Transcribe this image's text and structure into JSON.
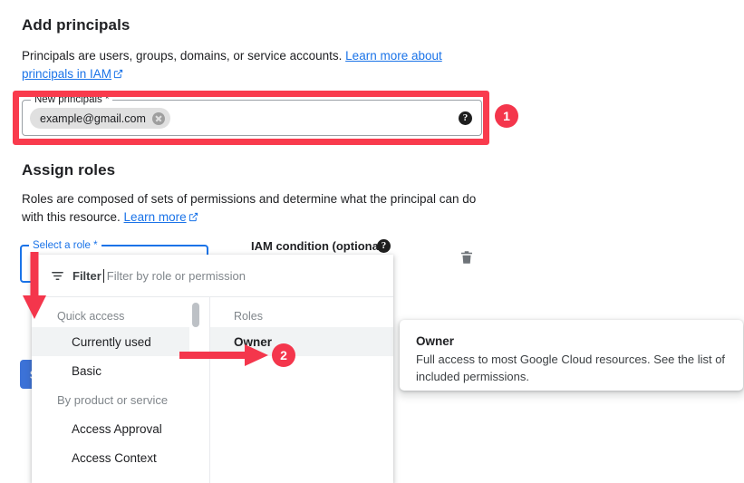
{
  "add_principals": {
    "title": "Add principals",
    "description_before": "Principals are users, groups, domains, or service accounts. ",
    "link_text": "Learn more about principals in IAM",
    "field_label": "New principals *",
    "chip_value": "example@gmail.com",
    "remove_icon": "close-circle-icon",
    "help_icon": "help-icon"
  },
  "assign_roles": {
    "title": "Assign roles",
    "description_before": "Roles are composed of sets of permissions and determine what the principal can do with this resource. ",
    "link_text": "Learn more",
    "role_field_label": "Select a role *",
    "iam_condition_label": "IAM condition (optional)",
    "iam_help_icon": "help-icon",
    "delete_icon": "trash-icon",
    "save_label": "S"
  },
  "role_dropdown": {
    "filter_icon": "filter-icon",
    "filter_label": "Filter",
    "filter_placeholder": "Filter by role or permission",
    "quick_access_header": "Quick access",
    "roles_header": "Roles",
    "quick_access_items": [
      {
        "label": "Currently used",
        "selected": true
      },
      {
        "label": "Basic",
        "selected": false
      }
    ],
    "group_label": "By product or service",
    "product_items": [
      {
        "label": "Access Approval"
      },
      {
        "label": "Access Context"
      }
    ],
    "roles": [
      {
        "label": "Owner",
        "highlighted": true
      }
    ]
  },
  "role_tooltip": {
    "title": "Owner",
    "description": "Full access to most Google Cloud resources. See the list of included permissions."
  },
  "annotations": {
    "badge_1": "1",
    "badge_2": "2",
    "accent_red": "#f4364c",
    "accent_blue": "#1a73e8"
  }
}
